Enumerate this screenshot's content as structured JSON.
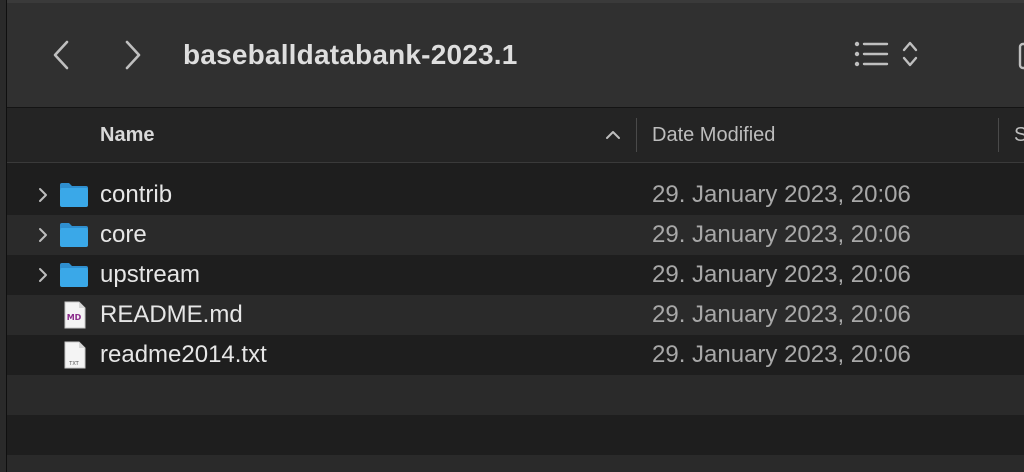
{
  "window": {
    "title": "baseballdatabank-2023.1"
  },
  "toolbar": {
    "back_icon": "chevron-left-icon",
    "forward_icon": "chevron-right-icon",
    "view_icon": "list-view-icon",
    "view_menu_icon": "up-down-chevron-icon"
  },
  "columns": {
    "name": "Name",
    "date_modified": "Date Modified",
    "size_partial": "S",
    "sort_direction": "ascending"
  },
  "files": [
    {
      "name": "contrib",
      "kind": "folder",
      "date": "29. January 2023, 20:06",
      "icon": "folder-icon"
    },
    {
      "name": "core",
      "kind": "folder",
      "date": "29. January 2023, 20:06",
      "icon": "folder-icon"
    },
    {
      "name": "upstream",
      "kind": "folder",
      "date": "29. January 2023, 20:06",
      "icon": "folder-icon"
    },
    {
      "name": "README.md",
      "kind": "file",
      "date": "29. January 2023, 20:06",
      "icon": "markdown-file-icon",
      "badge": "MD"
    },
    {
      "name": "readme2014.txt",
      "kind": "file",
      "date": "29. January 2023, 20:06",
      "icon": "text-file-icon",
      "badge": "TXT"
    }
  ],
  "colors": {
    "folder": "#3aa8e8",
    "row_alt": "#2a2a2a",
    "background": "#1e1e1e",
    "toolbar": "#303030",
    "md_badge": "#8a2a8a"
  }
}
